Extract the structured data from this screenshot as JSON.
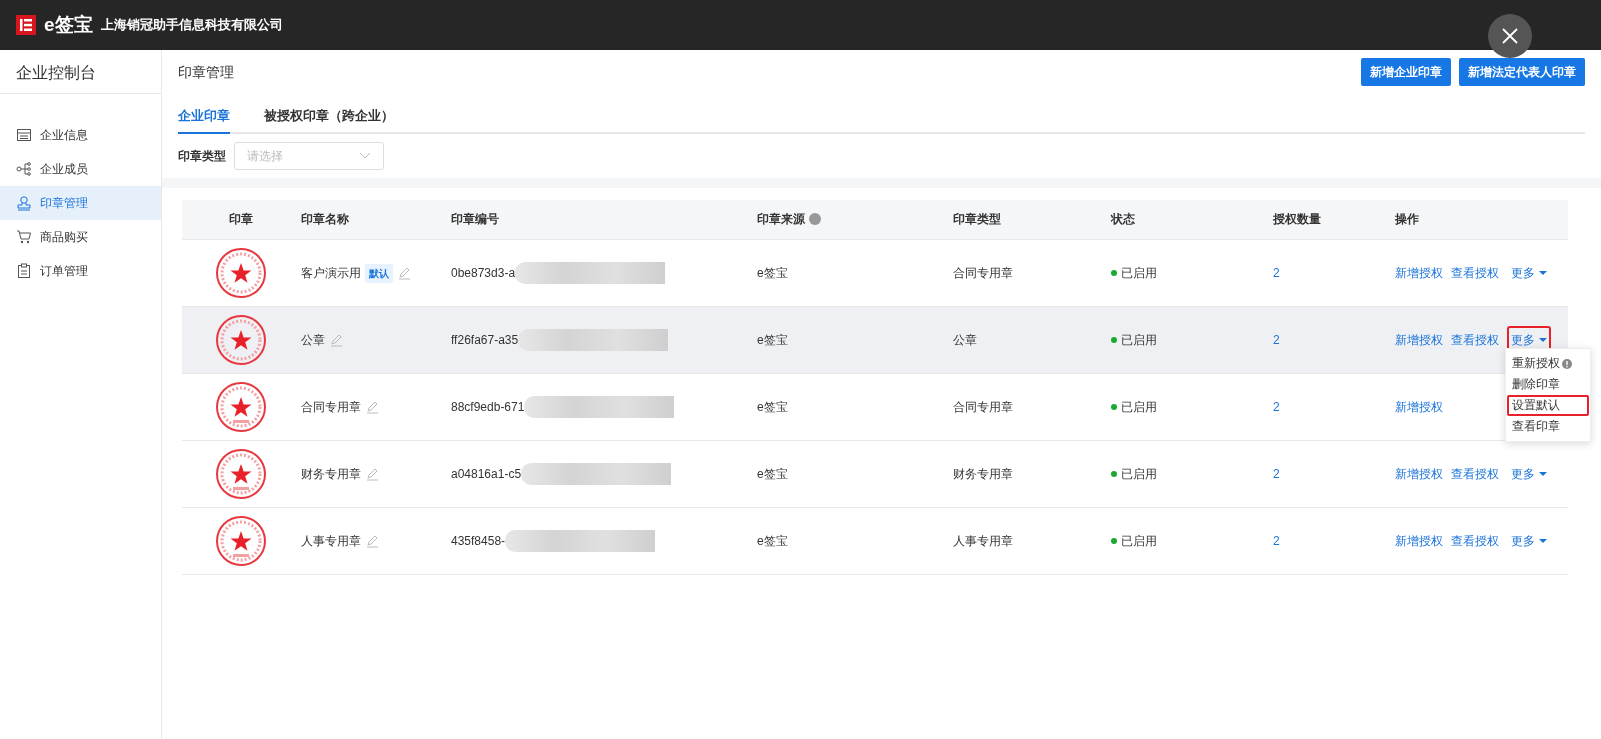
{
  "brand": {
    "logo_text": "e签宝",
    "company": "上海销冠助手信息科技有限公司"
  },
  "sidebar": {
    "title": "企业控制台",
    "items": [
      {
        "label": "企业信息",
        "selected": false,
        "kind": "info"
      },
      {
        "label": "企业成员",
        "selected": false,
        "kind": "members"
      },
      {
        "label": "印章管理",
        "selected": true,
        "kind": "seal"
      },
      {
        "label": "商品购买",
        "selected": false,
        "kind": "cart"
      },
      {
        "label": "订单管理",
        "selected": false,
        "kind": "order"
      }
    ]
  },
  "page": {
    "title": "印章管理",
    "buttons": [
      "新增企业印章",
      "新增法定代表人印章"
    ]
  },
  "tabs": [
    {
      "label": "企业印章",
      "selected": true
    },
    {
      "label": "被授权印章（跨企业）",
      "selected": false
    }
  ],
  "filter": {
    "label": "印章类型",
    "placeholder": "请选择"
  },
  "table": {
    "columns": [
      "印章",
      "印章名称",
      "印章编号",
      "印章来源",
      "印章类型",
      "状态",
      "授权数量",
      "操作"
    ],
    "rows": [
      {
        "seal_caption": false,
        "name": "客户演示用",
        "badge": "默认",
        "id": "0be873d3-a",
        "source": "e签宝",
        "type": "合同专用章",
        "status": "已启用",
        "count": "2",
        "actions": [
          "新增授权",
          "查看授权"
        ],
        "more": "更多",
        "hovered": false,
        "menu_open": false,
        "more_highlighted": false
      },
      {
        "seal_caption": false,
        "name": "公章",
        "id": "ff26fa67-a35",
        "source": "e签宝",
        "type": "公章",
        "status": "已启用",
        "count": "2",
        "actions": [
          "新增授权",
          "查看授权"
        ],
        "more": "更多",
        "hovered": true,
        "menu_open": true,
        "more_highlighted": true
      },
      {
        "seal_caption": true,
        "name": "合同专用章",
        "id": "88cf9edb-671",
        "source": "e签宝",
        "type": "合同专用章",
        "status": "已启用",
        "count": "2",
        "actions": [
          "新增授权"
        ],
        "hovered": false
      },
      {
        "seal_caption": true,
        "name": "财务专用章",
        "id": "a04816a1-c5",
        "source": "e签宝",
        "type": "财务专用章",
        "status": "已启用",
        "count": "2",
        "actions": [
          "新增授权",
          "查看授权"
        ],
        "more": "更多",
        "hovered": false,
        "menu_open": false,
        "more_highlighted": false
      },
      {
        "seal_caption": true,
        "name": "人事专用章",
        "id": "435f8458-",
        "source": "e签宝",
        "type": "人事专用章",
        "status": "已启用",
        "count": "2",
        "actions": [
          "新增授权",
          "查看授权"
        ],
        "more": "更多",
        "hovered": false,
        "menu_open": false,
        "more_highlighted": false
      }
    ],
    "menu": [
      {
        "label": "重新授权",
        "info": true,
        "highlighted": false
      },
      {
        "label": "删除印章",
        "info": false,
        "highlighted": false
      },
      {
        "label": "设置默认",
        "info": false,
        "highlighted": true
      },
      {
        "label": "查看印章",
        "info": false,
        "highlighted": false
      }
    ]
  }
}
